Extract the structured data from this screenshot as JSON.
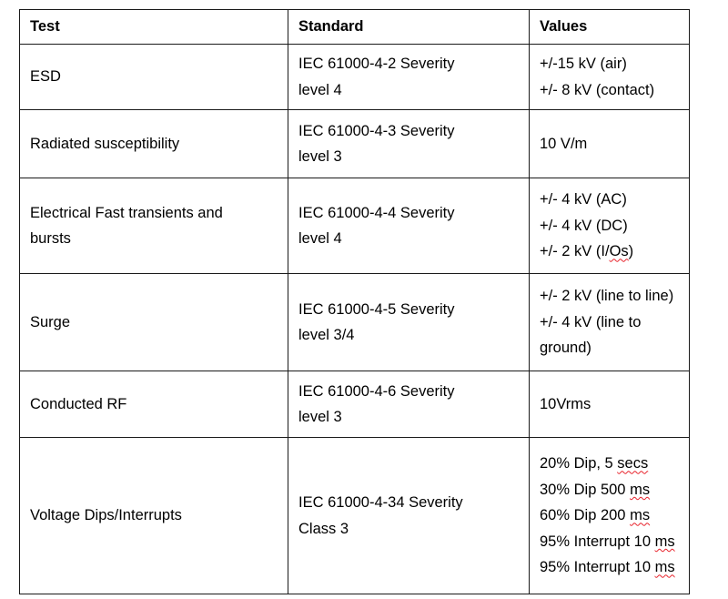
{
  "document": {
    "title": "EMC Immunity Test Requirements Table",
    "background_color": "#ffffff",
    "text_color": "#000000",
    "border_color": "#1a1a1a",
    "spellcheck_underline_color": "#e8212a"
  },
  "table": {
    "columns": [
      {
        "key": "test",
        "header": "Test"
      },
      {
        "key": "standard",
        "header": "Standard"
      },
      {
        "key": "values",
        "header": "Values"
      }
    ],
    "rows": [
      {
        "test": [
          "ESD"
        ],
        "standard": [
          "IEC 61000-4-2 Severity",
          "level 4"
        ],
        "values": [
          "+/-15 kV (air)",
          "+/- 8 kV (contact)"
        ],
        "values_misspelled": [
          "",
          ""
        ]
      },
      {
        "test": [
          "Radiated susceptibility"
        ],
        "standard": [
          "IEC 61000-4-3 Severity",
          "level 3"
        ],
        "values": [
          "10 V/m"
        ],
        "values_misspelled": [
          ""
        ]
      },
      {
        "test": [
          "Electrical Fast transients and",
          "bursts"
        ],
        "standard": [
          "IEC 61000-4-4 Severity",
          "level 4"
        ],
        "values": [
          "+/- 4 kV (AC)",
          "+/- 4 kV (DC)",
          "+/- 2 kV (I/Os)"
        ],
        "values_misspelled": [
          "",
          "",
          "Os"
        ]
      },
      {
        "test": [
          "Surge"
        ],
        "standard": [
          "IEC 61000-4-5 Severity",
          "level 3/4"
        ],
        "values": [
          "+/- 2 kV (line to line)",
          "+/- 4 kV (line to",
          "ground)"
        ],
        "values_misspelled": [
          "",
          "",
          ""
        ]
      },
      {
        "test": [
          "Conducted RF"
        ],
        "standard": [
          "IEC 61000-4-6 Severity",
          "level 3"
        ],
        "values": [
          "10Vrms"
        ],
        "values_misspelled": [
          ""
        ]
      },
      {
        "test": [
          "Voltage Dips/Interrupts"
        ],
        "standard": [
          "IEC 61000-4-34 Severity",
          "Class 3"
        ],
        "values": [
          "20% Dip, 5 secs",
          "30% Dip 500 ms",
          "60% Dip 200 ms",
          "95% Interrupt 10 ms",
          "95% Interrupt 10 ms"
        ],
        "values_misspelled": [
          "secs",
          "ms",
          "ms",
          "ms",
          "ms"
        ]
      }
    ]
  }
}
